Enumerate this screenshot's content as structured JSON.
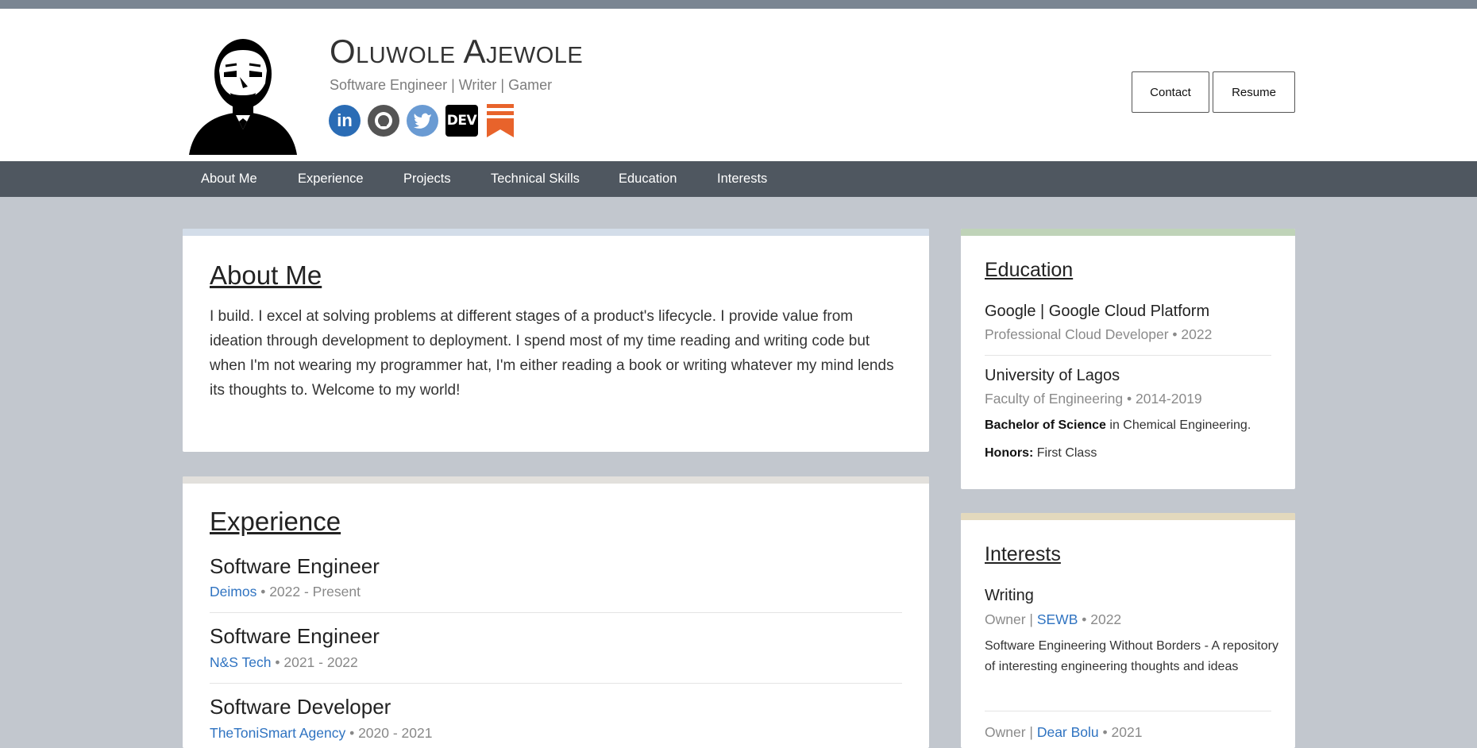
{
  "header": {
    "name": "Oluwole Ajewole",
    "tagline": "Software Engineer | Writer | Gamer",
    "socials": [
      {
        "icon": "linkedin-icon",
        "label": "in"
      },
      {
        "icon": "github-icon",
        "label": ""
      },
      {
        "icon": "twitter-icon",
        "label": ""
      },
      {
        "icon": "dev-icon",
        "label": "DEV"
      },
      {
        "icon": "substack-icon",
        "label": ""
      }
    ],
    "contact_label": "Contact",
    "resume_label": "Resume"
  },
  "nav": [
    "About Me",
    "Experience",
    "Projects",
    "Technical Skills",
    "Education",
    "Interests"
  ],
  "about": {
    "heading": "About Me",
    "text": "I build. I excel at solving problems at different stages of a product's lifecycle. I provide value from ideation through development to deployment. I spend most of my time reading and writing code but when I'm not wearing my programmer hat, I'm either reading a book or writing whatever my mind lends its thoughts to. Welcome to my world!"
  },
  "experience": {
    "heading": "Experience",
    "jobs": [
      {
        "title": "Software Engineer",
        "company": "Deimos",
        "period": "• 2022 - Present"
      },
      {
        "title": "Software Engineer",
        "company": "N&S Tech",
        "period": "• 2021 - 2022"
      },
      {
        "title": "Software Developer",
        "company": "TheToniSmart Agency",
        "period": "• 2020 - 2021"
      }
    ]
  },
  "education": {
    "heading": "Education",
    "items": [
      {
        "title": "Google | Google Cloud Platform",
        "meta": "Professional Cloud Developer • 2022"
      },
      {
        "title": "University of Lagos",
        "meta": "Faculty of Engineering • 2014-2019",
        "degree_bold": "Bachelor of Science",
        "degree_rest": " in Chemical Engineering.",
        "honors_bold": "Honors:",
        "honors_rest": " First Class"
      }
    ]
  },
  "interests": {
    "heading": "Interests",
    "items": [
      {
        "title": "Writing",
        "role": "Owner | ",
        "org": "SEWB",
        "year": " • 2022",
        "desc": "Software Engineering Without Borders - A repository of interesting engineering thoughts and ideas"
      },
      {
        "role": "Owner | ",
        "org": "Dear Bolu",
        "year": " • 2021"
      }
    ]
  },
  "colors": {
    "nav": "#4f5760",
    "link": "#2f73c1",
    "about_strip": "#d3dde9",
    "experience_strip": "#e2e0dc",
    "education_strip": "#bfd3b8",
    "interests_strip": "#e3d9bd"
  }
}
